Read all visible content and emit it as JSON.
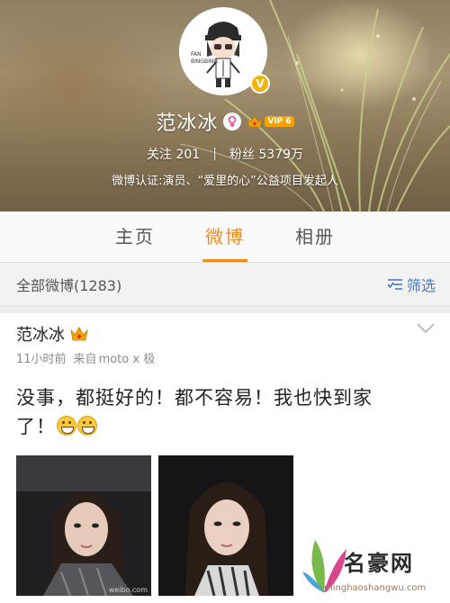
{
  "profile": {
    "name": "范冰冰",
    "avatar_caption": "FAN BINGBING",
    "verified_badge": "V",
    "vip_label": "VIP 6",
    "following_label": "关注",
    "following_count": "201",
    "separator": "|",
    "fans_label": "粉丝",
    "fans_count": "5379万",
    "verification": "微博认证:演员、“爱里的心”公益项目发起人"
  },
  "tabs": [
    {
      "label": "主页",
      "active": false
    },
    {
      "label": "微博",
      "active": true
    },
    {
      "label": "相册",
      "active": false
    }
  ],
  "filter": {
    "title": "全部微博(1283)",
    "button_label": "筛选"
  },
  "post": {
    "author": "范冰冰",
    "time": "11小时前",
    "source_prefix": "来自",
    "source": "moto x 极",
    "text_line1": "没事，都挺好的！都不容易！我也快到家",
    "text_line2": "了！",
    "photo_watermark": "weibo.com"
  },
  "watermark": {
    "name": "名豪网",
    "url": "minghaoshangwu.com"
  },
  "colors": {
    "accent": "#f28a1e",
    "link": "#4a77c1",
    "vip": "#f4a300",
    "female": "#e44a8d"
  }
}
